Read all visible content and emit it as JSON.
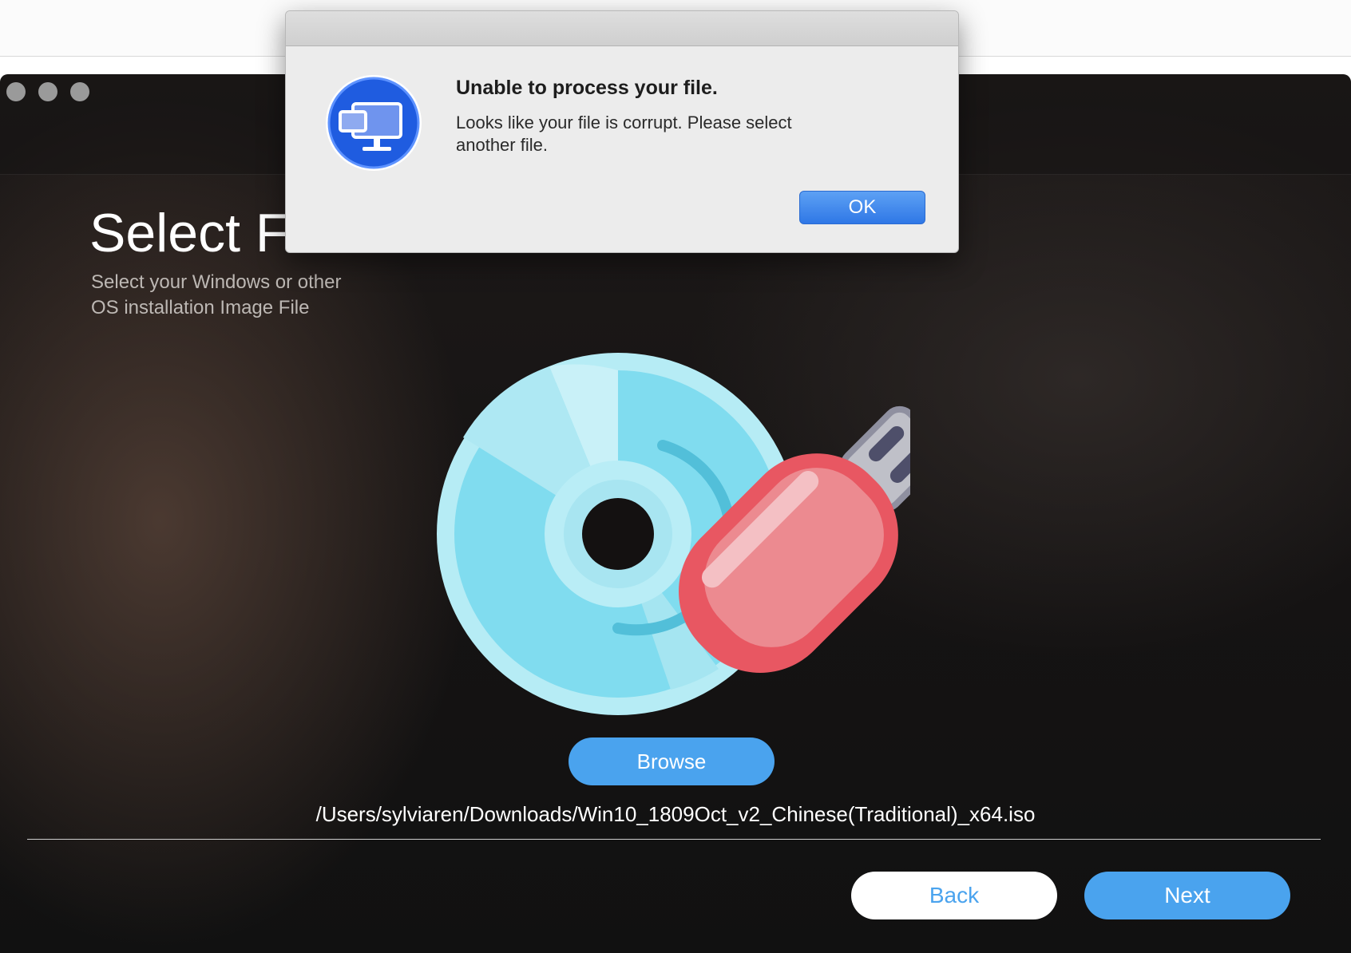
{
  "window": {
    "heading": "Select File",
    "subtitle": "Select your Windows or other OS installation Image File",
    "browse_label": "Browse",
    "file_path": "/Users/sylviaren/Downloads/Win10_1809Oct_v2_Chinese(Traditional)_x64.iso",
    "back_label": "Back",
    "next_label": "Next",
    "bottom_partial_text": "·"
  },
  "dialog": {
    "title": "Unable to process your file.",
    "message": "Looks like your file is corrupt. Please select\nanother  file.",
    "ok_label": "OK"
  },
  "colors": {
    "accent_blue": "#4aa3ee",
    "dialog_icon_blue": "#1f5ce0",
    "disc_cyan": "#7bdcef",
    "usb_red": "#e8656e"
  },
  "icons": {
    "dialog_icon": "monitor-window-icon",
    "illustration": "disc-usb-illustration"
  }
}
